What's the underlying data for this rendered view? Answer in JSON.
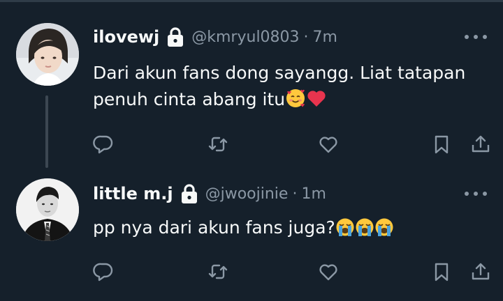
{
  "tweets": [
    {
      "display_name": "ilovewj",
      "handle": "@kmryul0803",
      "separator": "·",
      "time": "7m",
      "text": "Dari akun fans dong sayangg. Liat tatapan penuh cinta abang itu",
      "emojis": [
        "smiling-face-with-hearts",
        "red-heart"
      ]
    },
    {
      "display_name": "little m.j",
      "handle": "@jwoojinie",
      "separator": "·",
      "time": "1m",
      "text": "pp nya dari akun fans juga?",
      "emojis": [
        "loudly-crying-face",
        "loudly-crying-face",
        "loudly-crying-face"
      ]
    }
  ],
  "colors": {
    "background": "#15202b",
    "text": "#f7f9f9",
    "secondary": "#8b98a5",
    "thread_line": "#3c4752"
  },
  "icons": [
    "reply-icon",
    "retweet-icon",
    "like-icon",
    "bookmark-icon",
    "share-icon",
    "lock-icon",
    "more-icon"
  ]
}
